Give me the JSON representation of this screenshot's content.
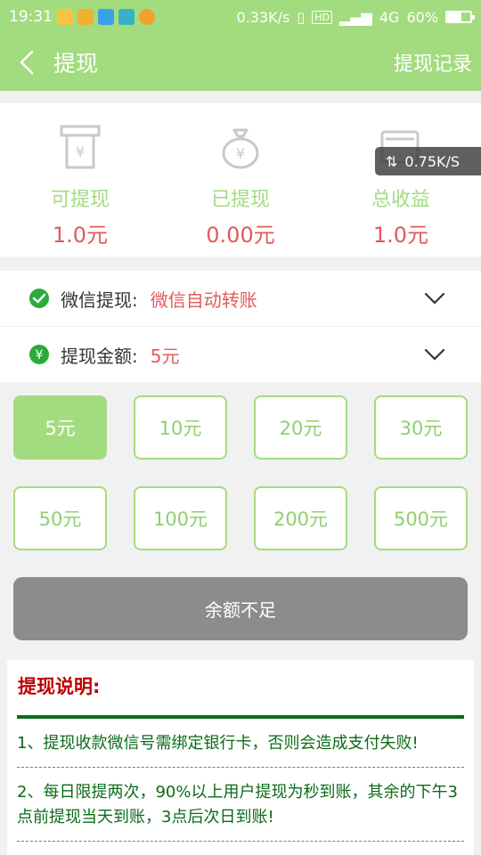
{
  "status_bar": {
    "time": "19:31",
    "net_speed": "0.33K/s",
    "hd_label": "HD",
    "network": "4G",
    "battery": "60%",
    "battery_level": 0.6
  },
  "header": {
    "title": "提现",
    "record_label": "提现记录"
  },
  "stats": [
    {
      "label": "可提现",
      "value": "1.0元"
    },
    {
      "label": "已提现",
      "value": "0.00元"
    },
    {
      "label": "总收益",
      "value": "1.0元"
    }
  ],
  "speed_overlay": "0.75K/S",
  "method_row": {
    "label": "微信提现:",
    "value": "微信自动转账"
  },
  "amount_row": {
    "label": "提现金额:",
    "value": "5元"
  },
  "amounts": [
    "5元",
    "10元",
    "20元",
    "30元",
    "50元",
    "100元",
    "200元",
    "500元"
  ],
  "selected_amount": "5元",
  "submit_label": "余额不足",
  "notes": {
    "title": "提现说明:",
    "items": [
      "1、提现收款微信号需绑定银行卡，否则会造成支付失败!",
      "2、每日限提两次，90%以上用户提现为秒到账，其余的下午3点前提现当天到账，3点后次日到账!"
    ]
  },
  "colors": {
    "brand": "#a3dc7f",
    "value_red": "#e05a5a",
    "note_green": "#0b6b18",
    "note_title": "#c00000",
    "button_disabled": "#8c8c8c"
  }
}
